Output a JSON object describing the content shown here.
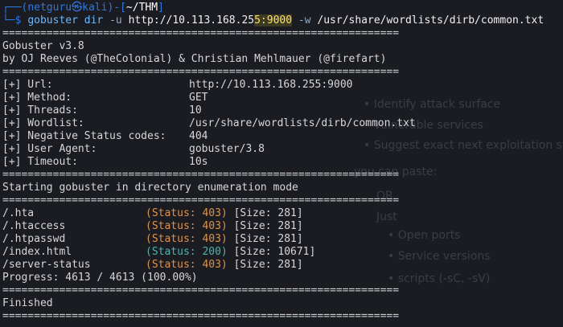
{
  "prompt": {
    "user": "netguru",
    "host": "kali",
    "dir": "~/THM",
    "symbol": "$"
  },
  "command": {
    "name": "gobuster",
    "subcmd": "dir",
    "url_flag": "-u",
    "url_before": "http://10.113.168.25",
    "url_highlight": "5:9000",
    "wordlist_flag": "-w",
    "wordlist": "/usr/share/wordlists/dirb/common.txt"
  },
  "separator": "===============================================================",
  "banner": {
    "version": "Gobuster v3.8",
    "authors": "by OJ Reeves (@TheColonial) & Christian Mehlmauer (@firefart)"
  },
  "config": [
    {
      "key": "[+] Url:",
      "value": "http://10.113.168.255:9000"
    },
    {
      "key": "[+] Method:",
      "value": "GET"
    },
    {
      "key": "[+] Threads:",
      "value": "10"
    },
    {
      "key": "[+] Wordlist:",
      "value": "/usr/share/wordlists/dirb/common.txt"
    },
    {
      "key": "[+] Negative Status codes:",
      "value": "404"
    },
    {
      "key": "[+] User Agent:",
      "value": "gobuster/3.8"
    },
    {
      "key": "[+] Timeout:",
      "value": "10s"
    }
  ],
  "start_message": "Starting gobuster in directory enumeration mode",
  "results": [
    {
      "path": "/.hta",
      "status": "(Status: 403)",
      "size": "[Size: 281]",
      "color": "#e0914a"
    },
    {
      "path": "/.htaccess",
      "status": "(Status: 403)",
      "size": "[Size: 281]",
      "color": "#e0914a"
    },
    {
      "path": "/.htpasswd",
      "status": "(Status: 403)",
      "size": "[Size: 281]",
      "color": "#e0914a"
    },
    {
      "path": "/index.html",
      "status": "(Status: 200)",
      "size": "[Size: 10671]",
      "color": "#4fb3b0"
    },
    {
      "path": "/server-status",
      "status": "(Status: 403)",
      "size": "[Size: 281]",
      "color": "#e0914a"
    }
  ],
  "progress": "Progress: 4613 / 4613 (100.00%)",
  "finished": "Finished",
  "background_ghost": {
    "items": [
      "Identify attack surface",
      "vulnerable services",
      "Suggest exact next exploitation st",
      "you can paste:",
      "OR",
      "Just",
      "Open ports",
      "Service versions",
      "scripts (-sC, -sV)"
    ]
  },
  "colors": {
    "background": "#1b1c22",
    "prompt_blue": "#2f77e0",
    "status_403": "#e0914a",
    "status_200": "#4fb3b0",
    "highlight": "#ffe066"
  }
}
